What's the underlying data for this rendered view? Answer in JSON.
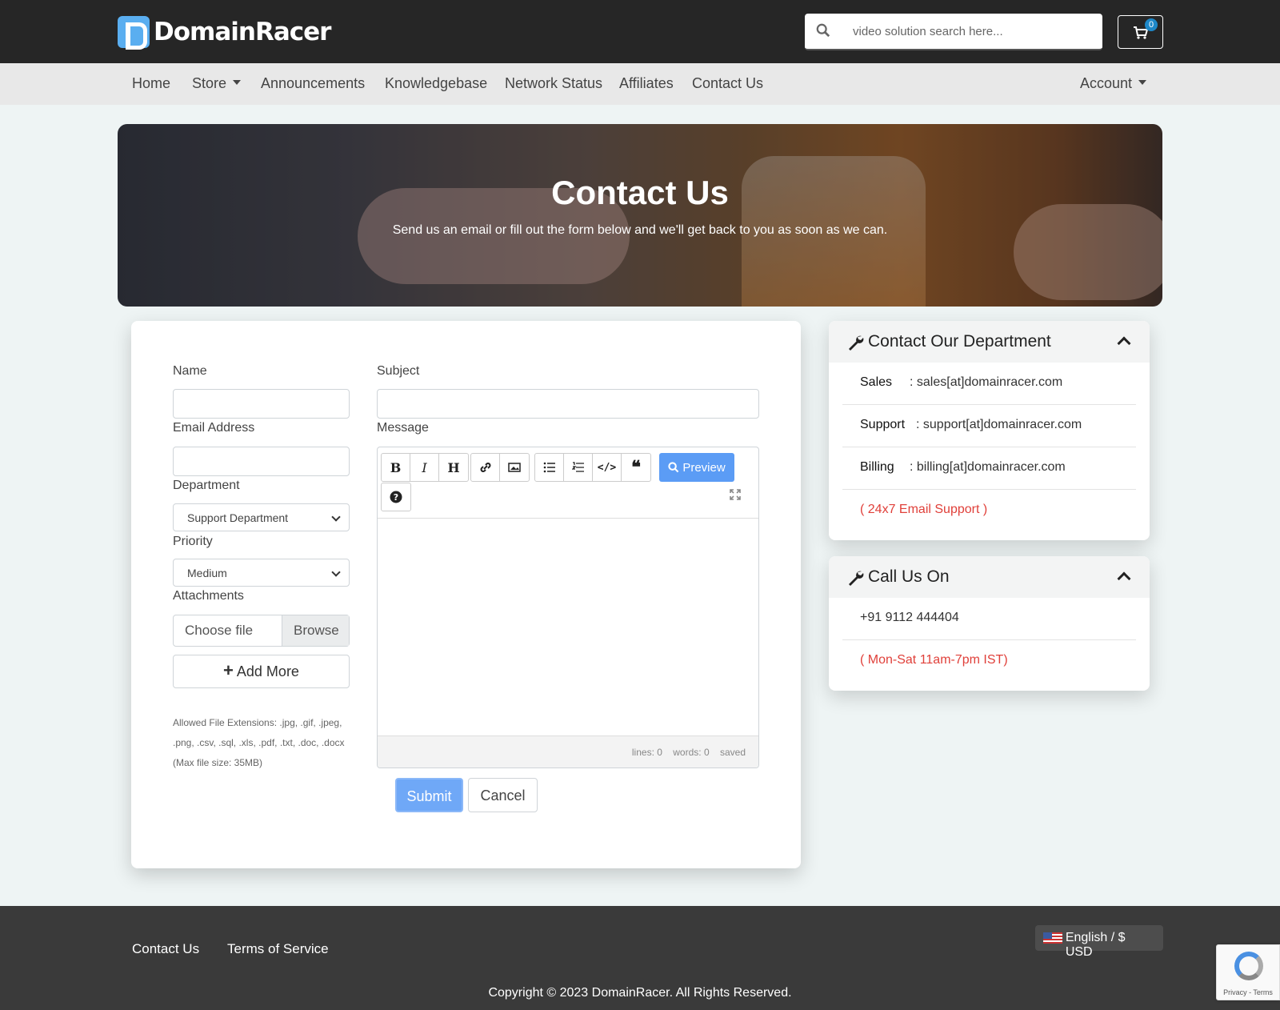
{
  "header": {
    "logo_text": "DomainRacer",
    "search_placeholder": "video solution search here...",
    "cart_count": "0"
  },
  "nav": {
    "items": [
      {
        "label": "Home"
      },
      {
        "label": "Store"
      },
      {
        "label": "Announcements"
      },
      {
        "label": "Knowledgebase"
      },
      {
        "label": "Network Status"
      },
      {
        "label": "Affiliates"
      },
      {
        "label": "Contact Us"
      }
    ],
    "account": "Account"
  },
  "banner": {
    "title": "Contact Us",
    "subtitle": "Send us an email or fill out the form below and we'll get back to you as soon as we can."
  },
  "form": {
    "name_label": "Name",
    "email_label": "Email Address",
    "department_label": "Department",
    "department_value": "Support Department",
    "priority_label": "Priority",
    "priority_value": "Medium",
    "attachments_label": "Attachments",
    "choose_file": "Choose file",
    "browse": "Browse",
    "add_more": "Add More",
    "allowed_extensions": "Allowed File Extensions: .jpg, .gif, .jpeg, .png, .csv, .sql, .xls, .pdf, .txt, .doc, .docx (Max file size: 35MB)",
    "subject_label": "Subject",
    "message_label": "Message",
    "preview": "Preview",
    "status_lines": "lines: 0",
    "status_words": "words: 0",
    "status_saved": "saved",
    "submit": "Submit",
    "cancel": "Cancel"
  },
  "department_panel": {
    "title": "Contact Our Department",
    "rows": [
      {
        "label": "Sales",
        "value": ": sales[at]domainracer.com"
      },
      {
        "label": "Support",
        "value": ": support[at]domainracer.com"
      },
      {
        "label": "Billing",
        "value": ": billing[at]domainracer.com"
      }
    ],
    "note": "( 24x7 Email Support )"
  },
  "call_panel": {
    "title": "Call Us On",
    "phone": "+91 9112 444404",
    "hours": "( Mon-Sat 11am-7pm IST)"
  },
  "footer": {
    "links": [
      "Contact Us",
      "Terms of Service"
    ],
    "language": "English / $ USD",
    "copyright": "Copyright © 2023 DomainRacer. All Rights Reserved.",
    "recaptcha": "Privacy - Terms"
  },
  "colors": {
    "topbar": "#262626",
    "accent": "#5b9cf5",
    "alert": "#e0403a"
  }
}
